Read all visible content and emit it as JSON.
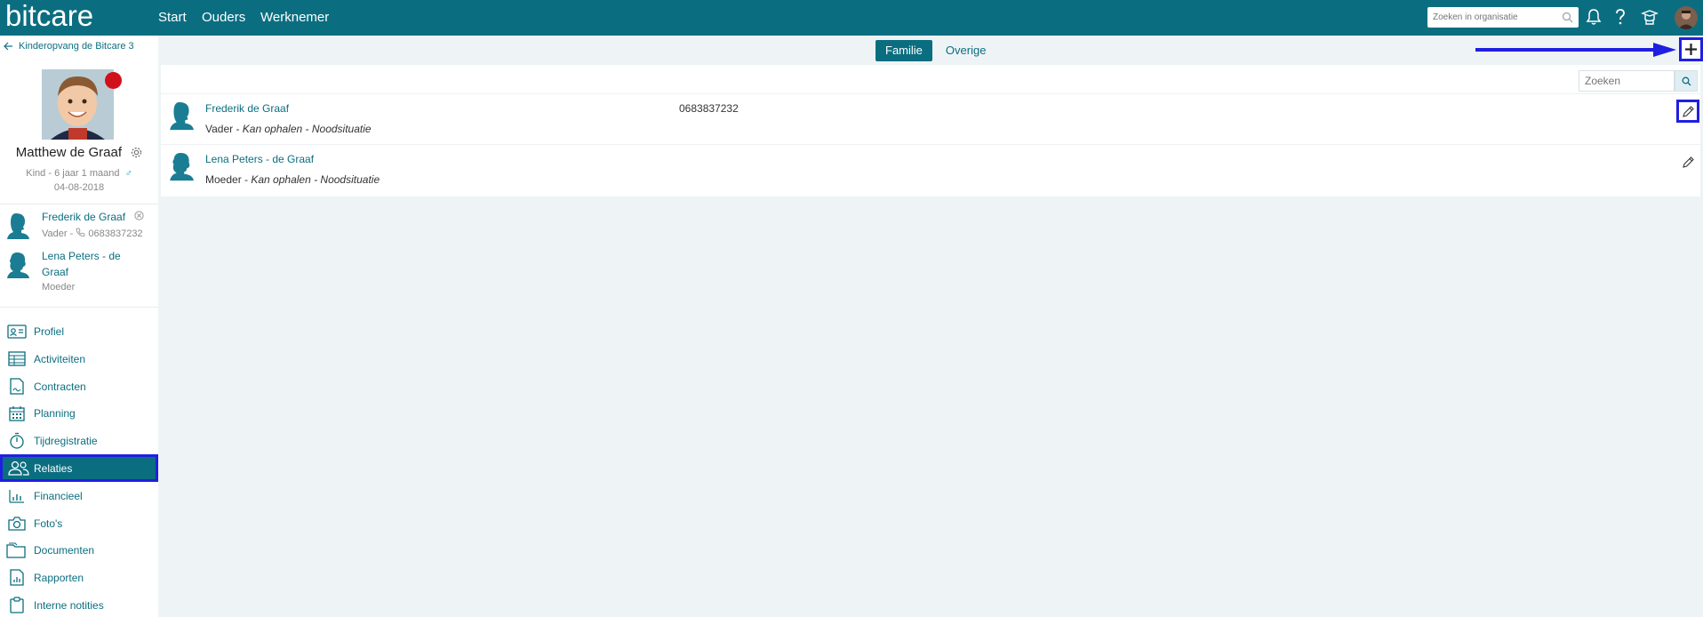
{
  "topbar": {
    "logo": "bitcare",
    "nav": [
      "Start",
      "Ouders",
      "Werknemer"
    ],
    "org_search_placeholder": "Zoeken in organisatie",
    "icons": [
      "search-icon",
      "bell-icon",
      "help-icon",
      "graduation-icon",
      "user-avatar"
    ]
  },
  "sidebar": {
    "back_label": "Kinderopvang de Bitcare 3",
    "child": {
      "name": "Matthew de Graaf",
      "meta": "Kind - 6 jaar 1 maand",
      "gender": "♂",
      "birthdate": "04-08-2018",
      "status_color": "#d0111b"
    },
    "relations": [
      {
        "name": "Frederik de Graaf",
        "sub": "Vader - ",
        "phone": "0683837232"
      },
      {
        "name": "Lena Peters - de Graaf",
        "sub": "Moeder"
      }
    ],
    "nav": [
      {
        "label": "Profiel",
        "icon": "id-card-icon"
      },
      {
        "label": "Activiteiten",
        "icon": "table-icon"
      },
      {
        "label": "Contracten",
        "icon": "contract-icon"
      },
      {
        "label": "Planning",
        "icon": "calendar-icon"
      },
      {
        "label": "Tijdregistratie",
        "icon": "stopwatch-icon"
      },
      {
        "label": "Relaties",
        "icon": "people-icon",
        "active": true
      },
      {
        "label": "Financieel",
        "icon": "bar-chart-icon"
      },
      {
        "label": "Foto's",
        "icon": "camera-icon"
      },
      {
        "label": "Documenten",
        "icon": "folder-icon"
      },
      {
        "label": "Rapporten",
        "icon": "report-icon"
      },
      {
        "label": "Interne notities",
        "icon": "clipboard-icon"
      }
    ]
  },
  "main": {
    "tabs": [
      {
        "label": "Familie",
        "active": true
      },
      {
        "label": "Overige",
        "active": false
      }
    ],
    "search_placeholder": "Zoeken",
    "rows": [
      {
        "name": "Frederik de Graaf",
        "role": "Vader - ",
        "tags": "Kan ophalen - Noodsituatie",
        "phone": "0683837232"
      },
      {
        "name": "Lena Peters - de Graaf",
        "role": "Moeder - ",
        "tags": "Kan ophalen - Noodsituatie",
        "phone": ""
      }
    ]
  },
  "colors": {
    "brand": "#0b6e80",
    "highlight": "#1f1fe0",
    "status": "#d0111b"
  }
}
